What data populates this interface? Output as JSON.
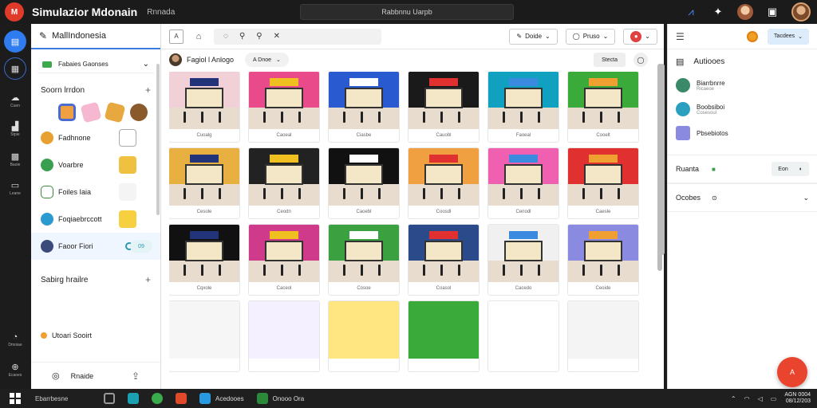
{
  "titlebar": {
    "logo_text": "M",
    "title": "Simulazior Mdonain",
    "subtitle": "Rnnada",
    "search_text": "Rabbnnu Uarpb"
  },
  "rail": {
    "items": [
      {
        "name": "home",
        "label": ""
      },
      {
        "name": "shop",
        "label": ""
      },
      {
        "name": "cloud",
        "label": "Cuen"
      },
      {
        "name": "store",
        "label": "Stpie"
      },
      {
        "name": "cart",
        "label": "Baoie"
      },
      {
        "name": "screen",
        "label": "Leane"
      },
      {
        "name": "timer",
        "label": "Dmoiae"
      },
      {
        "name": "add",
        "label": "Ecaoes"
      }
    ]
  },
  "leftpanel": {
    "header": "MallIndonesia",
    "select_label": "Fabaies Gaonses",
    "section1_title": "Soorn lrrdon",
    "items": [
      {
        "label": "Fadhnone"
      },
      {
        "label": "Voarbre"
      },
      {
        "label": "Foiles Iaia"
      },
      {
        "label": "Foqiaebrccott"
      },
      {
        "label": "Faoor Fiori",
        "badge": "09"
      }
    ],
    "section2_title": "Sabirg hrailre",
    "extra_item": "Utoari Sooirt",
    "footer_label": "Rnaide"
  },
  "main": {
    "search_icons": [
      "search",
      "search",
      "close"
    ],
    "btn_done": "Doide",
    "btn_pruso": "Pruso",
    "sub_title": "Fagiol l Anlogo",
    "sub_dropdown": "A Dnoe",
    "sort_label": "Stecta",
    "captions": [
      "Cuoalg",
      "Caoeal",
      "Ciasbe",
      "Cauobl",
      "Faoeal",
      "Cooelt",
      "Cesole",
      "Ceodn",
      "Caoebl",
      "Coosdl",
      "Cenodl",
      "Caesle",
      "Cqxole",
      "Caceol",
      "Cosoe",
      "Coasol",
      "Cacedo",
      "Ceoide"
    ]
  },
  "rightpanel": {
    "dropdown": "Tacdees",
    "section_title": "Autiooes",
    "rows": [
      {
        "title": "Biarrbnrre",
        "sub": "Ricaeoe"
      },
      {
        "title": "Boobsiboi",
        "sub": "Cosesoul"
      },
      {
        "title": "Pbsebiotos",
        "sub": ""
      }
    ],
    "card1_label": "Ruanta",
    "card1_chip": "Eon",
    "card2_label": "Ocobes"
  },
  "fab_label": "A",
  "taskbar": {
    "search_text": "Ebarrbesne",
    "apps": [
      {
        "label": ""
      },
      {
        "label": ""
      },
      {
        "label": ""
      },
      {
        "label": ""
      },
      {
        "label": "Acedooes"
      },
      {
        "label": "Onooo Ora"
      }
    ],
    "clock_time": "AGN 0004",
    "clock_date": "08/12/203"
  },
  "colors": {
    "accent": "#2f7bf0",
    "fab": "#e8442e",
    "logo": "#e03a2a"
  }
}
